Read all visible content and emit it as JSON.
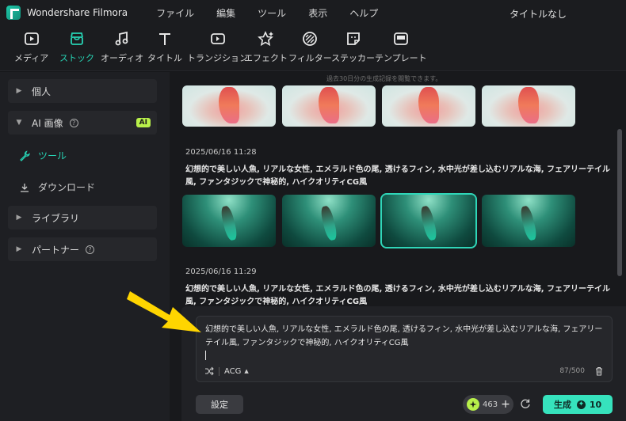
{
  "app": {
    "name": "Wondershare Filmora",
    "document_title": "タイトルなし"
  },
  "menu": [
    "ファイル",
    "編集",
    "ツール",
    "表示",
    "ヘルプ"
  ],
  "toolbar": [
    {
      "label": "メディア",
      "icon": "media-icon"
    },
    {
      "label": "ストック",
      "icon": "stock-icon",
      "active": true
    },
    {
      "label": "オーディオ",
      "icon": "music-note-icon"
    },
    {
      "label": "タイトル",
      "icon": "title-T-icon"
    },
    {
      "label": "トランジション",
      "icon": "transition-icon"
    },
    {
      "label": "エフェクト",
      "icon": "effect-star-icon"
    },
    {
      "label": "フィルター",
      "icon": "filter-icon"
    },
    {
      "label": "ステッカー",
      "icon": "sticker-icon"
    },
    {
      "label": "テンプレート",
      "icon": "template-icon"
    }
  ],
  "sidebar": {
    "personal": "個人",
    "ai_image": "AI 画像",
    "ai_badge": "AI",
    "tools": "ツール",
    "download": "ダウンロード",
    "library": "ライブラリ",
    "partner": "パートナー"
  },
  "main": {
    "notice": "過去30日分の生成記録を閲覧できます。",
    "entries": [
      {
        "timestamp": "2025/06/16 11:28",
        "prompt": "幻想的で美しい人魚, リアルな女性, エメラルド色の尾, 透けるフィン, 水中光が差し込むリアルな海, フェアリーテイル風, ファンタジックで神秘的, ハイクオリティCG風"
      },
      {
        "timestamp": "2025/06/16 11:29",
        "prompt": "幻想的で美しい人魚, リアルな女性, エメラルド色の尾, 透けるフィン, 水中光が差し込むリアルな海, フェアリーテイル風, ファンタジックで神秘的, ハイクオリティCG風"
      }
    ]
  },
  "editor": {
    "text": "幻想的で美しい人魚, リアルな女性, エメラルド色の尾, 透けるフィン, 水中光が差し込むリアルな海, フェアリーテイル風, ファンタジックで神秘的, ハイクオリティCG風",
    "style": "ACG",
    "count": "87/500"
  },
  "footer": {
    "settings": "設定",
    "credits": "463",
    "generate": "生成",
    "generate_cost": "10"
  },
  "colors": {
    "accent": "#27d3b4",
    "generate": "#36e2bd",
    "credit": "#b8f04a",
    "arrow": "#ffd500"
  }
}
